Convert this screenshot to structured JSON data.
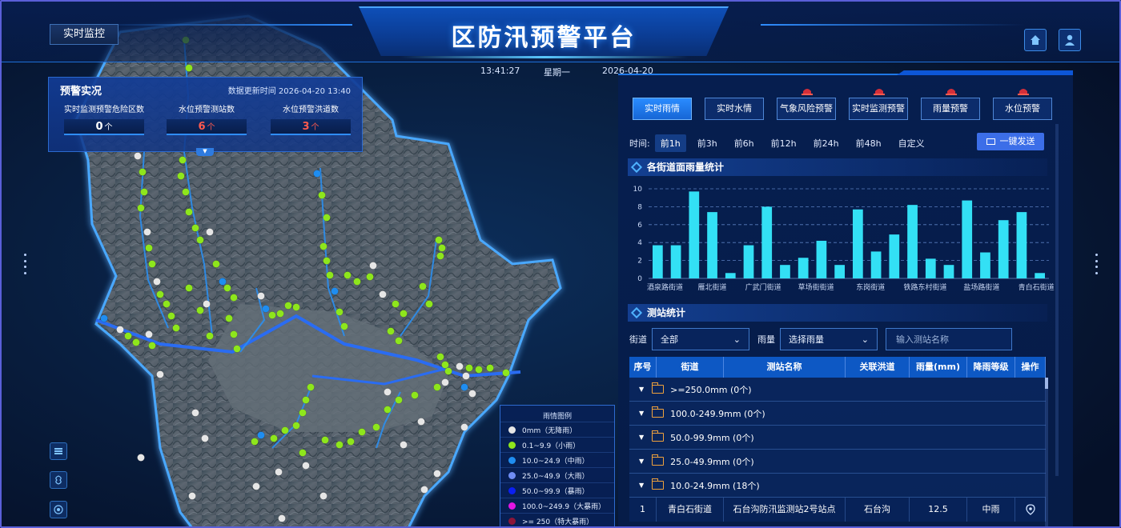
{
  "header": {
    "title": "区防汛预警平台",
    "nav_tab": "实时监控",
    "time": "13:41:27",
    "weekday": "星期一",
    "date": "2026-04-20",
    "icons": [
      "home-icon",
      "user-icon"
    ]
  },
  "alert_panel": {
    "title": "预警实况",
    "update_time": "数据更新时间 2026-04-20 13:40",
    "stats": [
      {
        "label": "实时监测预警危险区数",
        "value": "0",
        "unit": "个",
        "color": "#ffffff"
      },
      {
        "label": "水位预警测站数",
        "value": "6",
        "unit": "个",
        "color": "#ff5a4e"
      },
      {
        "label": "水位预警洪道数",
        "value": "3",
        "unit": "个",
        "color": "#ff5a4e"
      }
    ]
  },
  "legend": {
    "title": "雨情图例",
    "items": [
      {
        "label": "0mm（无降雨）",
        "color": "#e6e6e6"
      },
      {
        "label": "0.1~9.9（小雨）",
        "color": "#8ee61c"
      },
      {
        "label": "10.0~24.9（中雨）",
        "color": "#1f8df0"
      },
      {
        "label": "25.0~49.9（大雨）",
        "color": "#6f8df5"
      },
      {
        "label": "50.0~99.9（暴雨）",
        "color": "#0b1ff2"
      },
      {
        "label": "100.0~249.9（大暴雨）",
        "color": "#e515e5"
      },
      {
        "label": ">= 250（特大暴雨）",
        "color": "#8b1538"
      }
    ]
  },
  "right_panel": {
    "tabs": [
      {
        "label": "实时雨情",
        "active": true,
        "alarm": false
      },
      {
        "label": "实时水情",
        "active": false,
        "alarm": false
      },
      {
        "label": "气象风险预警",
        "active": false,
        "alarm": true
      },
      {
        "label": "实时监测预警",
        "active": false,
        "alarm": true
      },
      {
        "label": "雨量预警",
        "active": false,
        "alarm": true
      },
      {
        "label": "水位预警",
        "active": false,
        "alarm": true
      }
    ],
    "time_filter": {
      "label": "时间:",
      "options": [
        "前1h",
        "前3h",
        "前6h",
        "前12h",
        "前24h",
        "前48h",
        "自定义"
      ],
      "selected": "前1h"
    },
    "send_button": "一键发送",
    "rain_section_title": "各街道面雨量统计",
    "station_section_title": "测站统计",
    "filters": {
      "street_label": "街道",
      "street_value": "全部",
      "rain_label": "雨量",
      "rain_placeholder": "选择雨量",
      "station_placeholder": "输入测站名称"
    },
    "table": {
      "headers": [
        "序号",
        "街道",
        "测站名称",
        "关联洪道",
        "雨量(mm)",
        "降雨等级",
        "操作"
      ],
      "groups": [
        ">=250.0mm (0个)",
        "100.0-249.9mm (0个)",
        "50.0-99.9mm (0个)",
        "25.0-49.9mm (0个)",
        "10.0-24.9mm (18个)"
      ],
      "rows": [
        {
          "no": "1",
          "street": "青白石街道",
          "station": "石台沟防汛监测站2号站点",
          "channel": "石台沟",
          "rain": "12.5",
          "level": "中雨"
        }
      ]
    }
  },
  "chart_data": {
    "type": "bar",
    "title": "各街道面雨量统计",
    "ylim": [
      0,
      10
    ],
    "yticks": [
      0,
      2,
      4,
      6,
      8,
      10
    ],
    "grid": true,
    "tick_labels": [
      "酒泉路街道",
      "雁北街道",
      "广武门街道",
      "草场街街道",
      "东岗街道",
      "铁路东村街道",
      "盐场路街道",
      "青白石街道"
    ],
    "values": [
      3.7,
      3.7,
      9.7,
      7.4,
      0.6,
      3.7,
      8.0,
      1.5,
      2.3,
      4.2,
      1.5,
      7.7,
      3.0,
      4.9,
      8.2,
      2.2,
      1.5,
      8.7,
      2.9,
      6.5,
      7.4,
      0.6
    ],
    "color": "#33e0f5"
  },
  "side_icons": [
    "layer-icon",
    "typhoon-icon",
    "target-icon"
  ]
}
